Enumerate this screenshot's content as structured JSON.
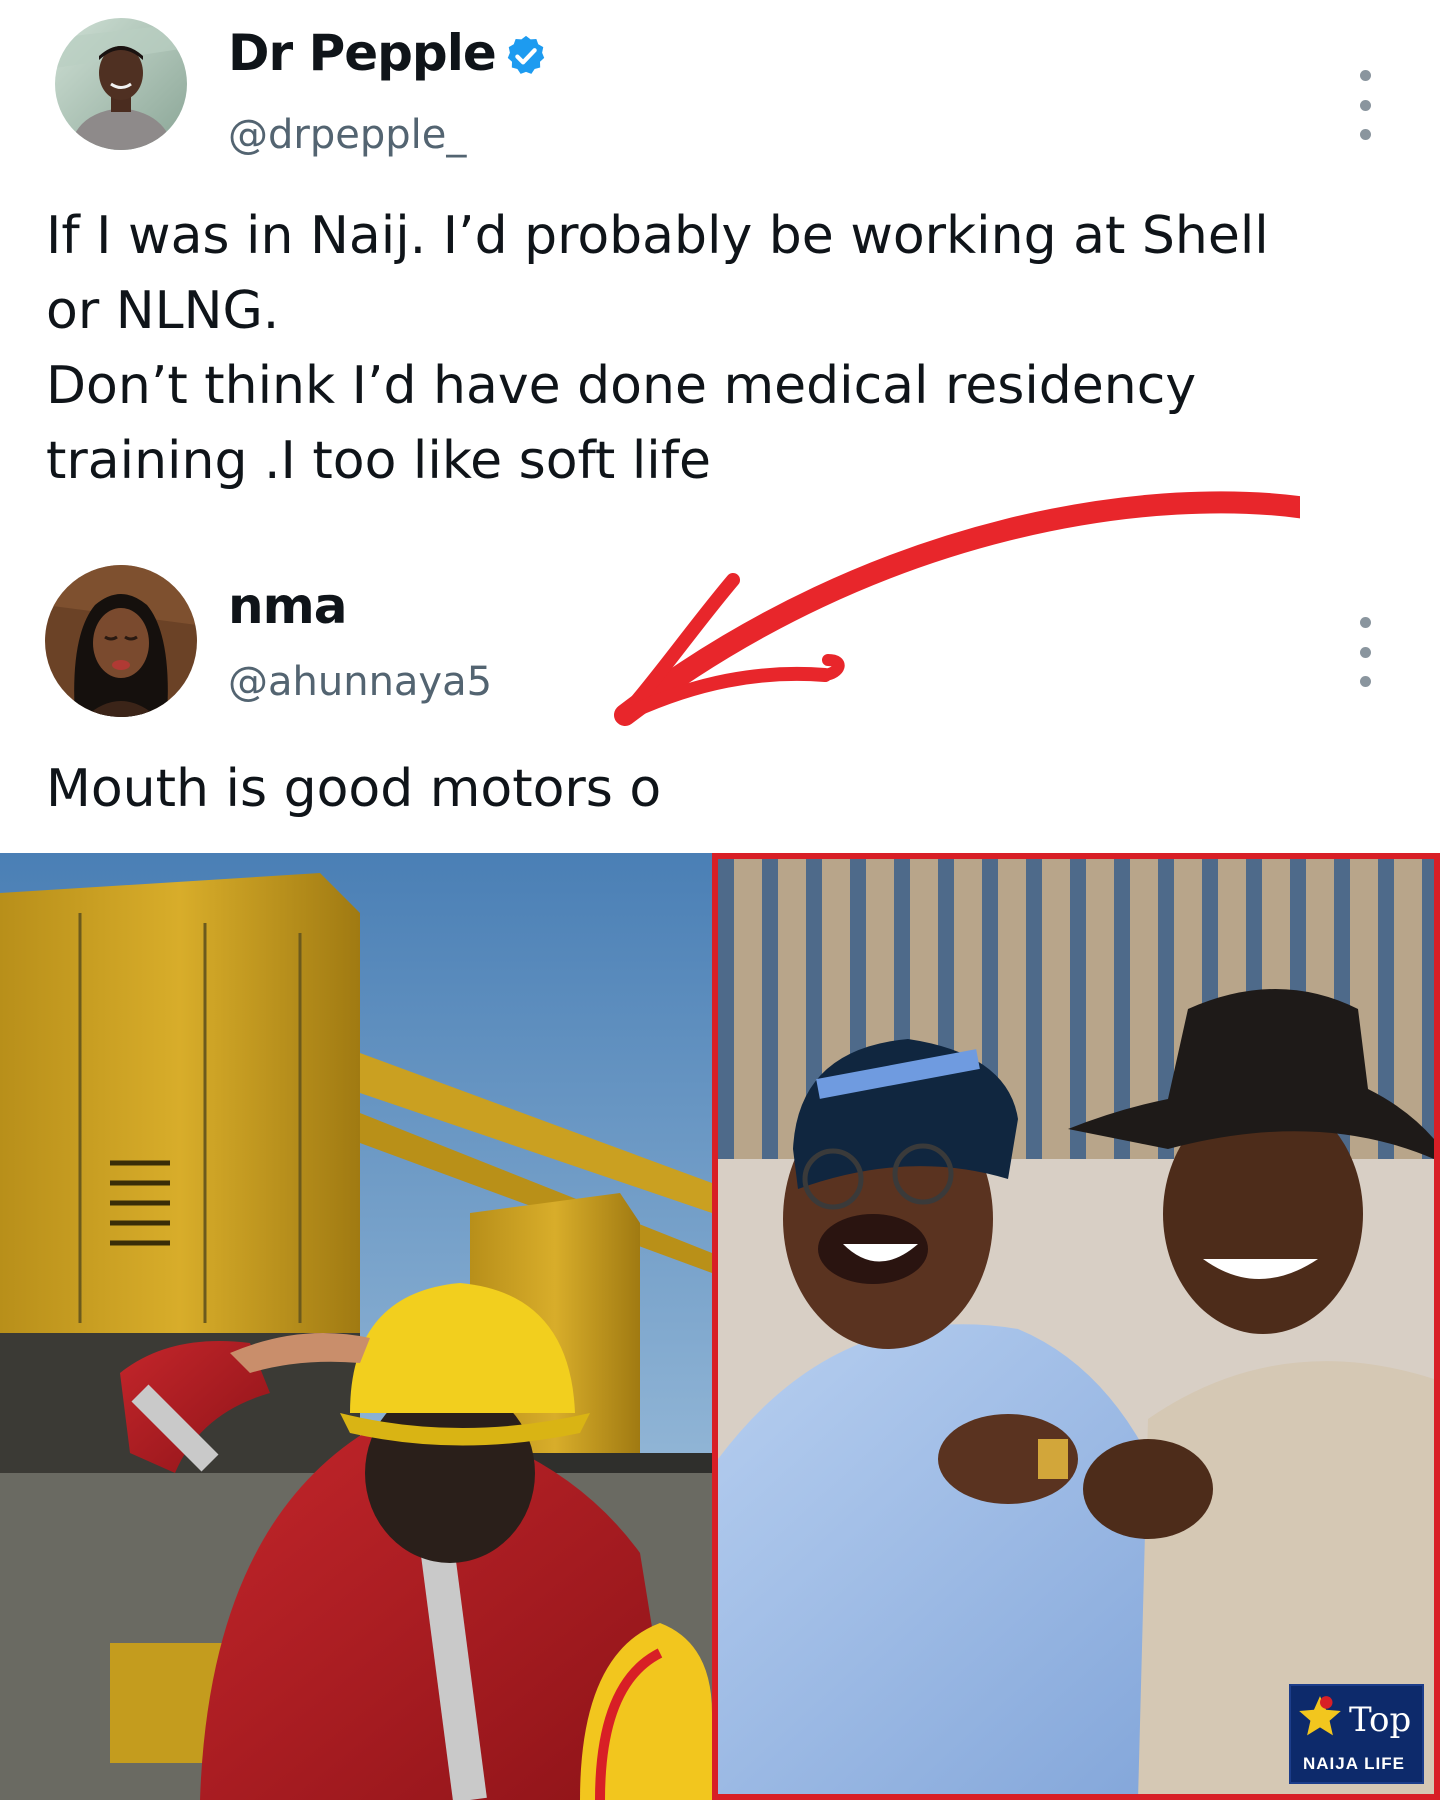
{
  "tweet1": {
    "display_name": "Dr Pepple",
    "handle": "@drpepple_",
    "verified_icon": "verified-badge-icon",
    "text": "If I was in Naij. I’d probably be working at Shell\nor NLNG.\nDon’t think I’d have done medical residency\ntraining .I too like soft life",
    "more_icon": "more-options-icon"
  },
  "tweet2": {
    "display_name": "nma",
    "handle": "@ahunnaya5",
    "text": "Mouth is good motors o",
    "more_icon": "more-options-icon"
  },
  "annotation": {
    "arrow_color": "#e8262b",
    "arrow_icon": "red-arrow-icon"
  },
  "photos": {
    "left_icon": "shell-worker-photo",
    "right_icon": "two-men-laughing-photo",
    "frame_color": "#d81f26"
  },
  "logo": {
    "name_part1": "Top",
    "name_part2": "NAIJA LIFE",
    "icon": "star-logo-icon"
  },
  "colors": {
    "verified_blue": "#1d9bf0",
    "handle_gray": "#536471"
  }
}
